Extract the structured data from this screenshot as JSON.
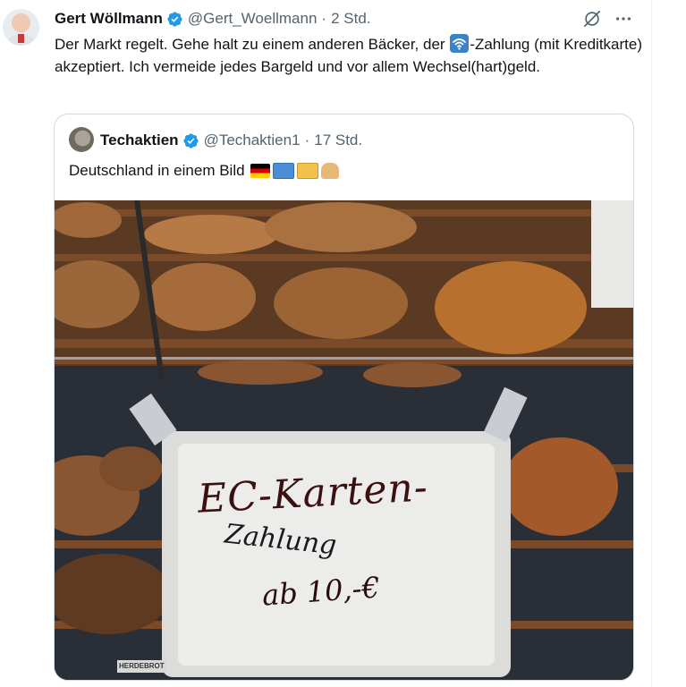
{
  "tweet": {
    "author_name": "Gert Wöllmann",
    "handle": "@Gert_Woellmann",
    "separator": "·",
    "time": "2 Std.",
    "text_part1": "Der Markt regelt. Gehe halt zu einem anderen Bäcker, der ",
    "text_part2": "-Zahlung (mit Kreditkarte) akzeptiert. Ich vermeide jedes Bargeld und vor allem Wechsel(hart)geld.",
    "icons": {
      "verified": "verified-badge-icon",
      "grok": "grok-icon",
      "more": "more-icon",
      "contactless": "contactless-icon"
    }
  },
  "quote": {
    "author_name": "Techaktien",
    "handle": "@Techaktien1",
    "separator": "·",
    "time": "17 Std.",
    "text": "Deutschland in einem Bild",
    "emojis": [
      "flag-germany",
      "euro-banknote",
      "credit-card",
      "bread"
    ]
  },
  "photo": {
    "sign_line1": "EC-Karten-",
    "sign_line2": "Zahlung",
    "sign_line3": "ab 10,-€",
    "small_label": "HERDEBROT"
  },
  "colors": {
    "verified": "#1d9bf0",
    "secondary_text": "#536471",
    "border": "#cfd9de"
  }
}
